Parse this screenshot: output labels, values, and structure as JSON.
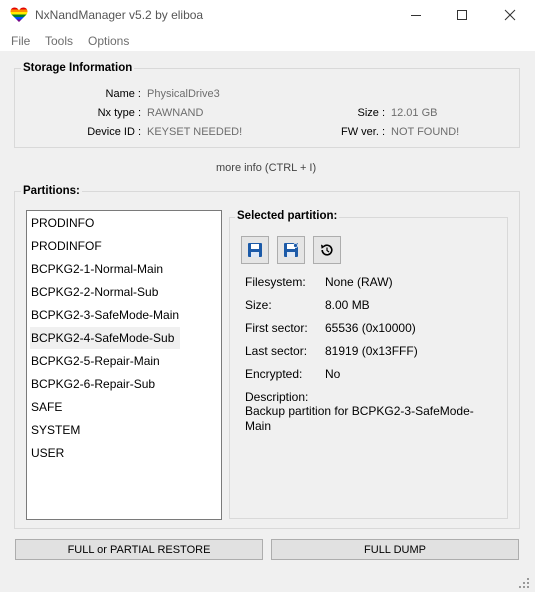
{
  "window": {
    "title": "NxNandManager v5.2 by eliboa"
  },
  "menu": {
    "items": [
      "File",
      "Tools",
      "Options"
    ]
  },
  "storage": {
    "group_title": "Storage Information",
    "name_label": "Name :",
    "name_value": "PhysicalDrive3",
    "nxtype_label": "Nx type :",
    "nxtype_value": "RAWNAND",
    "deviceid_label": "Device ID :",
    "deviceid_value": "KEYSET NEEDED!",
    "size_label": "Size :",
    "size_value": "12.01 GB",
    "fw_label": "FW ver. :",
    "fw_value": "NOT FOUND!",
    "more_info": "more info (CTRL + I)"
  },
  "partitions": {
    "group_title": "Partitions:",
    "items": [
      "PRODINFO",
      "PRODINFOF",
      "BCPKG2-1-Normal-Main",
      "BCPKG2-2-Normal-Sub",
      "BCPKG2-3-SafeMode-Main",
      "BCPKG2-4-SafeMode-Sub",
      "BCPKG2-5-Repair-Main",
      "BCPKG2-6-Repair-Sub",
      "SAFE",
      "SYSTEM",
      "USER"
    ],
    "selected_index": 5
  },
  "selected": {
    "group_title": "Selected partition:",
    "toolbar_icons": [
      "save-icon",
      "save-as-icon",
      "restore-icon"
    ],
    "filesystem_label": "Filesystem:",
    "filesystem_value": "None (RAW)",
    "size_label": "Size:",
    "size_value": "8.00 MB",
    "first_sector_label": "First sector:",
    "first_sector_value": "65536 (0x10000)",
    "last_sector_label": "Last sector:",
    "last_sector_value": "81919 (0x13FFF)",
    "encrypted_label": "Encrypted:",
    "encrypted_value": "No",
    "description_label": "Description:",
    "description_line1": "Backup partition for BCPKG2-3-SafeMode-",
    "description_line2": "Main"
  },
  "buttons": {
    "restore_label": "FULL or PARTIAL RESTORE",
    "dump_label": "FULL DUMP"
  },
  "colors": {
    "accent_blue": "#1c5aa8",
    "window_bg": "#f0f0f0",
    "muted_text": "#6d6d6d",
    "selection_bg": "#f0f0f0"
  }
}
